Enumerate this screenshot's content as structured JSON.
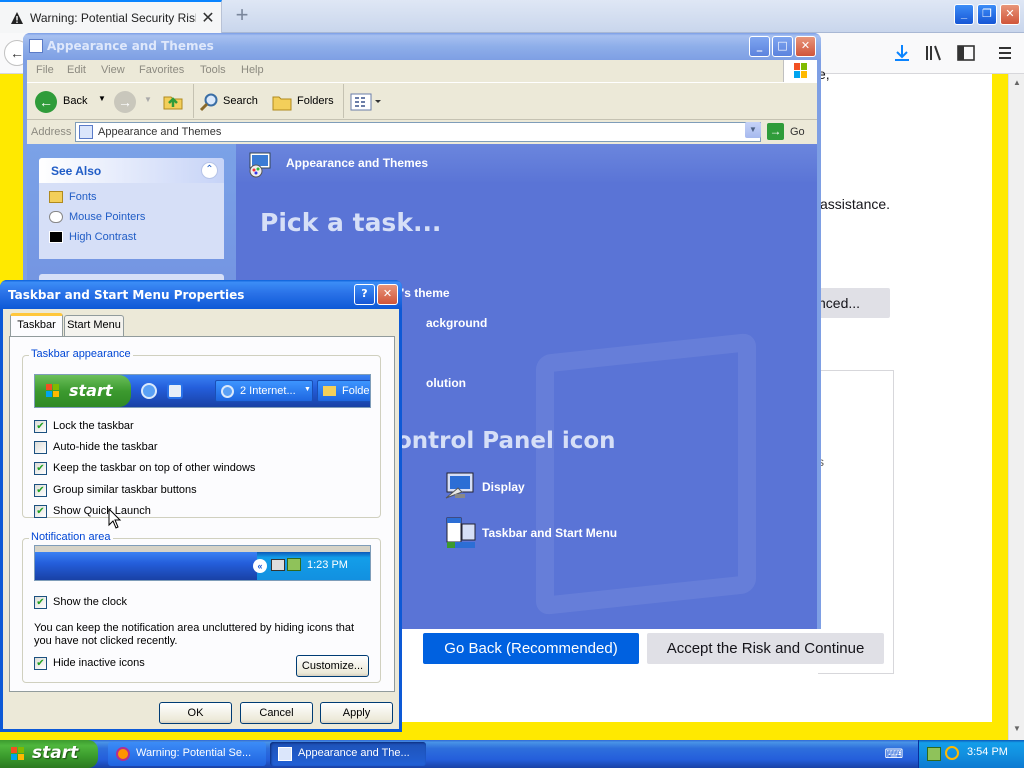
{
  "firefox": {
    "tab_title": "Warning: Potential Security Risk Ahead",
    "new_tab": "+",
    "window_buttons": [
      "_",
      "❐",
      "✕"
    ],
    "back_glyph": "←",
    "partial_text_1": "e,",
    "partial_text_2": "assistance.",
    "advanced_button": "nced...",
    "partial_text_3": "s",
    "go_back_button": "Go Back (Recommended)",
    "accept_button": "Accept the Risk and Continue"
  },
  "control_panel": {
    "title": "Appearance and Themes",
    "window_buttons": [
      "_",
      "□",
      "✕"
    ],
    "menu": [
      "File",
      "Edit",
      "View",
      "Favorites",
      "Tools",
      "Help"
    ],
    "toolbar": {
      "back": "Back",
      "search": "Search",
      "folders": "Folders"
    },
    "address_label": "Address",
    "address_value": "Appearance and Themes",
    "go_label": "Go",
    "see_also": {
      "title": "See Also",
      "links": [
        "Fonts",
        "Mouse Pointers",
        "High Contrast"
      ]
    },
    "banner_title": "Appearance and Themes",
    "pick_task": "Pick a task...",
    "tasks": [
      "Change the computer's theme",
      "ackground",
      "",
      "olution"
    ],
    "or_pick": "ontrol Panel icon",
    "icons": [
      "Display",
      "Taskbar and Start Menu"
    ]
  },
  "dialog": {
    "title": "Taskbar and Start Menu Properties",
    "help_glyph": "?",
    "close_glyph": "✕",
    "tabs": [
      "Taskbar",
      "Start Menu"
    ],
    "taskbar_appearance": {
      "legend": "Taskbar appearance",
      "preview": {
        "start": "start",
        "button1": "2 Internet...",
        "button2": "Folde"
      },
      "options": [
        {
          "label": "Lock the taskbar",
          "checked": true
        },
        {
          "label": "Auto-hide the taskbar",
          "checked": false
        },
        {
          "label": "Keep the taskbar on top of other windows",
          "checked": true
        },
        {
          "label": "Group similar taskbar buttons",
          "checked": true
        },
        {
          "label": "Show Quick Launch",
          "checked": true
        }
      ]
    },
    "notification_area": {
      "legend": "Notification area",
      "preview_time": "1:23 PM",
      "show_clock": {
        "label": "Show the clock",
        "checked": true
      },
      "description": "You can keep the notification area uncluttered by hiding icons that you have not clicked recently.",
      "hide_inactive": {
        "label": "Hide inactive icons",
        "checked": true
      },
      "customize_button": "Customize..."
    },
    "buttons": {
      "ok": "OK",
      "cancel": "Cancel",
      "apply": "Apply"
    }
  },
  "taskbar": {
    "start": "start",
    "tasks": [
      "Warning: Potential Se...",
      "Appearance and The..."
    ],
    "clock": "3:54 PM"
  },
  "colors": {
    "xp_blue": "#0d59d6",
    "firefox_primary": "#0061e0",
    "warning_yellow": "#ffe900",
    "start_green": "#3c9a2f",
    "cp_task_pane": "#5a74d6"
  }
}
